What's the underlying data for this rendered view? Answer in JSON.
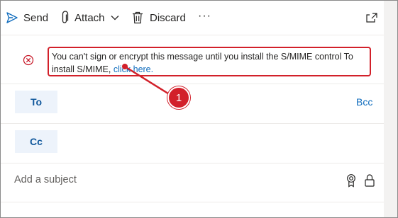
{
  "toolbar": {
    "send_label": "Send",
    "attach_label": "Attach",
    "discard_label": "Discard",
    "more_label": "···"
  },
  "smime_notice": {
    "message": "You can't sign or encrypt this message until you install the S/MIME control To install S/MIME,",
    "link_text": "click here."
  },
  "recipients": {
    "to_label": "To",
    "cc_label": "Cc",
    "bcc_label": "Bcc"
  },
  "subject": {
    "placeholder": "Add a subject"
  },
  "callout": {
    "number": "1"
  },
  "colors": {
    "accent": "#0f6cbd",
    "callout_red": "#d2202a",
    "error_red": "#c50f1f"
  }
}
